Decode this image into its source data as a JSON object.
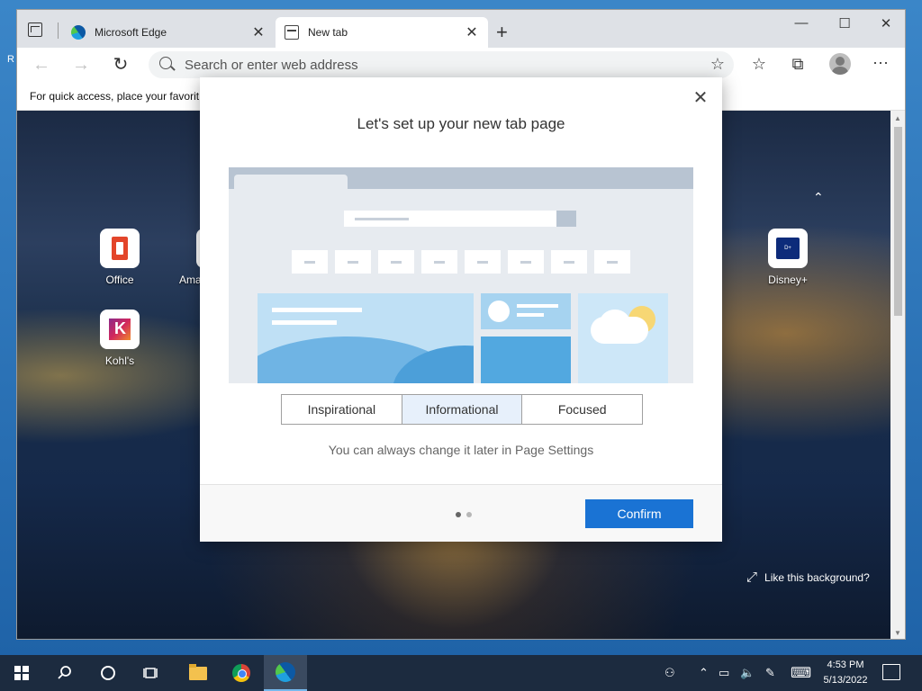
{
  "desktop": {
    "edge_letter": "R"
  },
  "browser": {
    "tabs": [
      {
        "title": "Microsoft Edge",
        "icon": "edge-logo-icon",
        "close": "✕"
      },
      {
        "title": "New tab",
        "icon": "new-tab-icon",
        "close": "✕"
      }
    ],
    "window_controls": {
      "minimize": "—",
      "maximize": "☐",
      "close": "✕"
    },
    "new_tab_symbol": "+",
    "toolbar": {
      "back": "←",
      "forward": "→",
      "refresh": "↻",
      "address_placeholder": "Search or enter web address",
      "add_favorite": "☆",
      "favorites": "☆",
      "collections": "⧉",
      "more": "···"
    },
    "favorites_bar_text": "For quick access, place your favorit"
  },
  "new_tab_page": {
    "tiles": [
      {
        "label": "Office",
        "icon": "office-icon"
      },
      {
        "label": "Kohl's",
        "icon": "kohls-icon"
      },
      {
        "label": "Disney+",
        "icon": "disney-plus-icon"
      }
    ],
    "partial_tile_label": "Ama",
    "collapse_symbol": "⌃",
    "like_background": "Like this background?",
    "expand_symbol": "⤢"
  },
  "modal": {
    "title": "Let's set up your new tab page",
    "close": "✕",
    "layout_options": [
      "Inspirational",
      "Informational",
      "Focused"
    ],
    "selected_option": "Informational",
    "hint": "You can always change it later in Page Settings",
    "confirm": "Confirm",
    "pager": {
      "total": 2,
      "current": 1
    }
  },
  "taskbar": {
    "tray": {
      "people": "⚇",
      "chevron": "⌃",
      "network": "▭",
      "volume": "🔈",
      "pen": "✎",
      "keyboard": "⌨"
    },
    "time": "4:53 PM",
    "date": "5/13/2022"
  }
}
